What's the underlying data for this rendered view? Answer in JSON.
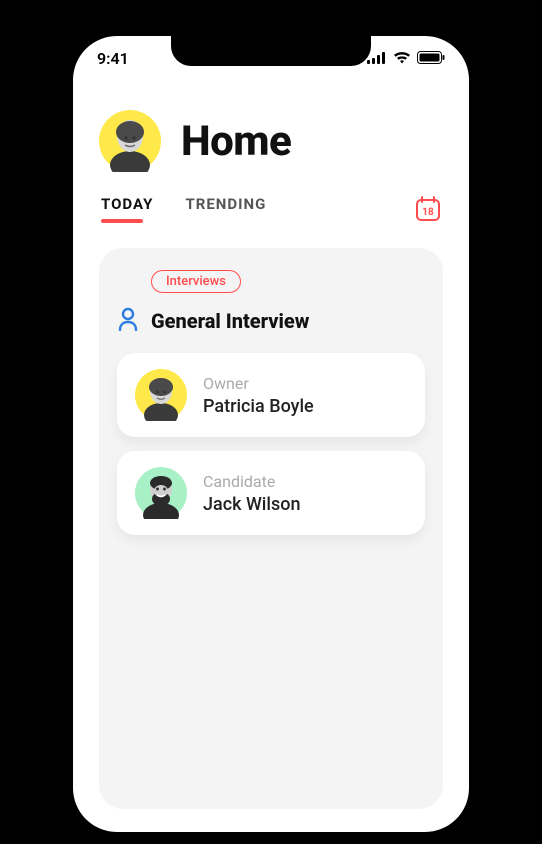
{
  "status_bar": {
    "time": "9:41"
  },
  "header": {
    "title": "Home",
    "avatar_bg": "#ffe94a"
  },
  "tabs": {
    "today": "TODAY",
    "trending": "TRENDING"
  },
  "calendar": {
    "day": "18",
    "color": "#ff4d4d"
  },
  "section": {
    "badge": "Interviews",
    "title": "General Interview"
  },
  "people": {
    "owner": {
      "role": "Owner",
      "name": "Patricia Boyle",
      "avatar_bg": "#ffe94a"
    },
    "candidate": {
      "role": "Candidate",
      "name": "Jack Wilson",
      "avatar_bg": "#a8f0c6"
    }
  }
}
